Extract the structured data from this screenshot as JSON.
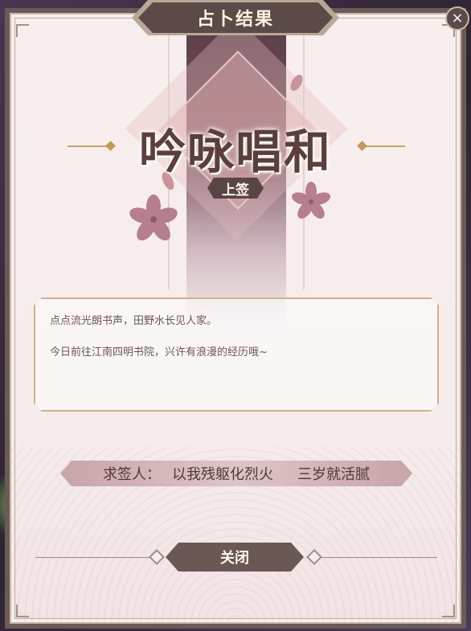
{
  "dialog": {
    "title": "占卜结果",
    "close_icon": "×"
  },
  "fortune": {
    "name": "吟咏唱和",
    "level": "上签"
  },
  "poem": {
    "line1": "点点流光朗书声，田野水长见人家。",
    "line2": "今日前往江南四明书院，兴许有浪漫的经历哦~"
  },
  "seeker": {
    "label": "求签人：",
    "name": "以我残躯化烈火",
    "server": "三岁就活腻"
  },
  "footer": {
    "close_label": "关闭"
  },
  "colors": {
    "frame": "#6b5a57",
    "accent_gold": "#c39a5a",
    "petal": "#b57f8c"
  }
}
